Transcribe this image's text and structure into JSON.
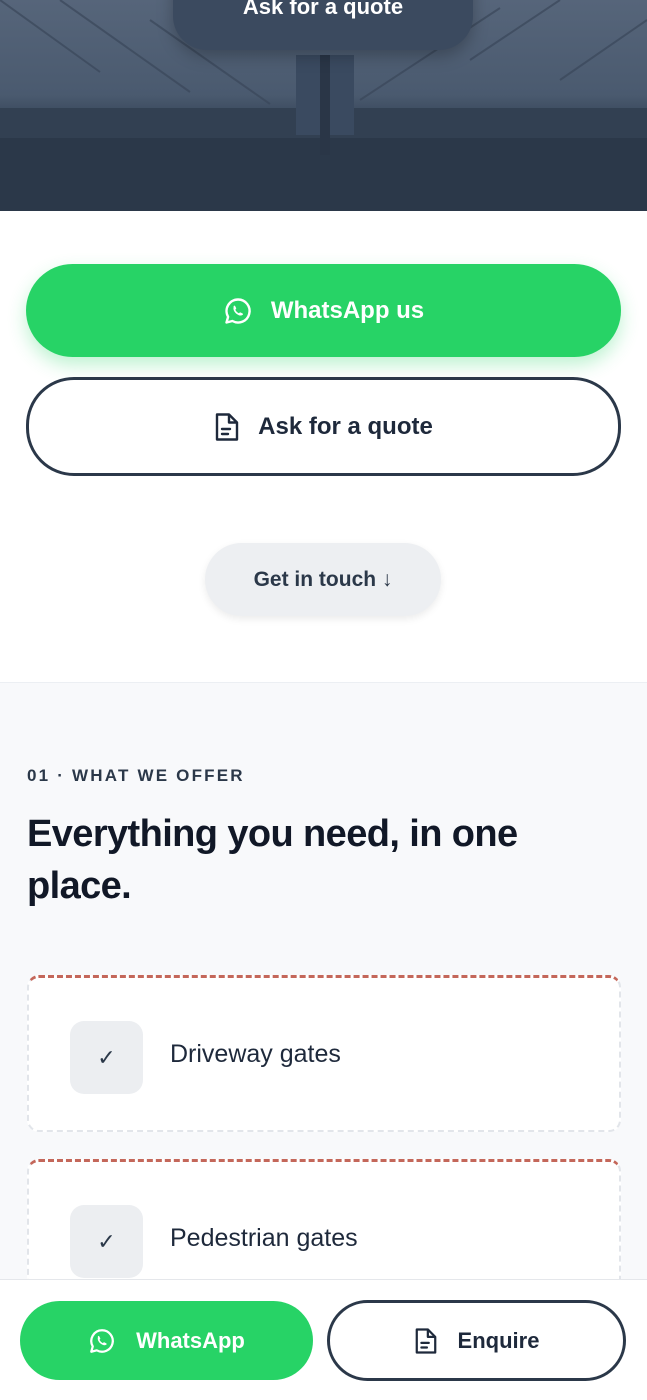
{
  "hero": {
    "quote_button_label": "Ask for a quote"
  },
  "cta": {
    "whatsapp_label": "WhatsApp us",
    "whatsapp_icon": "whatsapp-icon",
    "quote_label": "Ask for a quote",
    "quote_icon": "document-icon",
    "get_in_touch_label": "Get in touch ↓"
  },
  "offer": {
    "eyebrow": "01 · WHAT WE OFFER",
    "headline": "Everything you need, in one place.",
    "items": [
      {
        "label": "Driveway gates",
        "check": "✓"
      },
      {
        "label": "Pedestrian gates",
        "check": "✓"
      }
    ]
  },
  "bottom_bar": {
    "whatsapp_label": "WhatsApp",
    "enquire_label": "Enquire"
  },
  "colors": {
    "whatsapp_green": "#27d366",
    "navy": "#2b3849",
    "card_accent": "#c4675a"
  }
}
